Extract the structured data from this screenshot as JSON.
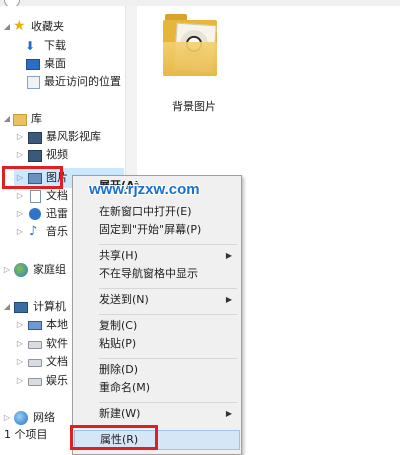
{
  "nav": {
    "favorites": "收藏夹",
    "downloads": "下载",
    "desktop": "桌面",
    "recent": "最近访问的位置",
    "libraries": "库",
    "storm_video": "暴风影视库",
    "videos": "视频",
    "pictures": "图片",
    "documents": "文档",
    "thunder": "迅雷",
    "music": "音乐",
    "homegroup": "家庭组",
    "computer": "计算机",
    "local_disk": "本地",
    "software": "软件",
    "docs_drive": "文档",
    "entertainment": "娱乐",
    "network": "网络"
  },
  "status": {
    "item_count": "1 个项目"
  },
  "main": {
    "folder_label": "背景图片"
  },
  "menu": {
    "expand": "展开(A)",
    "open_new_window": "在新窗口中打开(E)",
    "pin_start": "固定到\"开始\"屏幕(P)",
    "share": "共享(H)",
    "hide_nav": "不在导航窗格中显示",
    "send_to": "发送到(N)",
    "copy": "复制(C)",
    "paste": "粘贴(P)",
    "delete": "删除(D)",
    "rename": "重命名(M)",
    "new": "新建(W)",
    "properties": "属性(R)"
  },
  "watermark": "www.rjzxw.com",
  "colors": {
    "highlight": "#cce8ff",
    "annotation": "#e02020",
    "watermark": "#1a6fd0"
  }
}
